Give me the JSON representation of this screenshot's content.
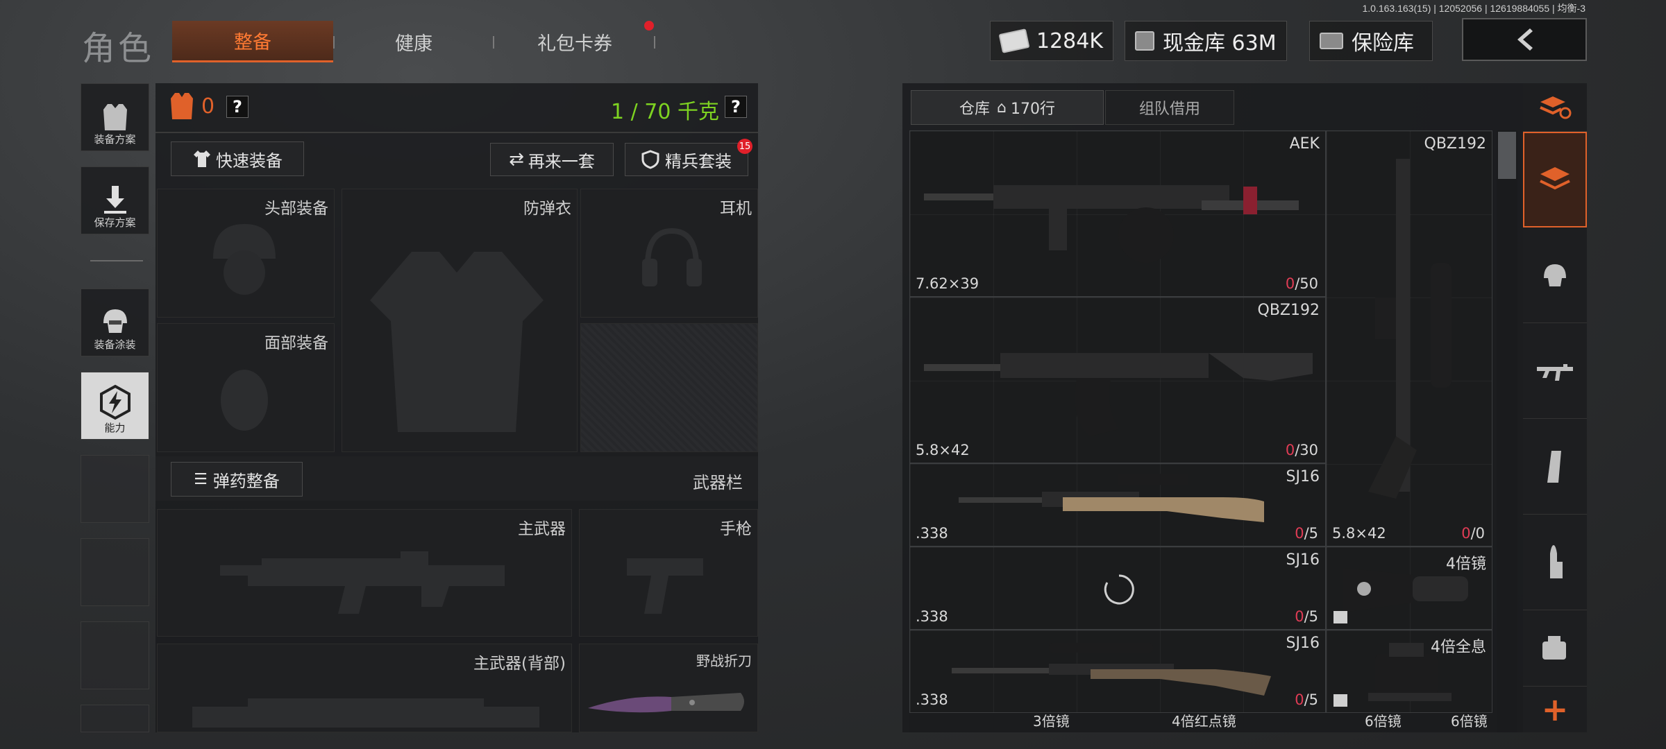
{
  "version_text": "1.0.163.163(15) | 12052056 | 12619884055 | 均衡-3",
  "page_title": "角色",
  "tabs": [
    {
      "label": "整备",
      "active": true
    },
    {
      "label": "健康",
      "active": false
    },
    {
      "label": "礼包卡券",
      "active": false,
      "has_badge": true
    }
  ],
  "currencies": [
    {
      "label": "1284K",
      "icon": "cash-icon"
    },
    {
      "label": "现金库 63M",
      "icon": "vault-icon"
    },
    {
      "label": "保险库",
      "icon": "safe-icon"
    }
  ],
  "side_buttons": [
    {
      "label": "装备方案",
      "icon": "vest-icon"
    },
    {
      "label": "保存方案",
      "icon": "download-icon"
    },
    {
      "label": "装备涂装",
      "icon": "helmet-icon"
    },
    {
      "label": "能力",
      "icon": "lightning-icon",
      "active": true
    }
  ],
  "loadout": {
    "armor_count": "0",
    "weight": "1 / 70 千克",
    "quick_equip": "快速装备",
    "again_label": "再来一套",
    "elite_label": "精兵套装",
    "elite_badge": "15",
    "slots": {
      "head": "头部装备",
      "vest": "防弹衣",
      "headset": "耳机",
      "face": "面部装备"
    },
    "ammo_equip": "弹药整备",
    "weapon_bar": "武器栏",
    "weapon_slots": {
      "primary": "主武器",
      "pistol": "手枪",
      "primary_back": "主武器(背部)",
      "knife": "野战折刀"
    }
  },
  "storage": {
    "tabs": [
      {
        "label": "仓库",
        "extra": "170行",
        "active": true
      },
      {
        "label": "组队借用",
        "active": false
      }
    ],
    "items": [
      {
        "name": "AEK",
        "caliber": "7.62×39",
        "ammo_cur": "0",
        "ammo_max": "/50"
      },
      {
        "name": "QBZ192",
        "caliber": "5.8×42",
        "ammo_cur": "0",
        "ammo_max": "/0"
      },
      {
        "name": "QBZ192",
        "caliber": "5.8×42",
        "ammo_cur": "0",
        "ammo_max": "/30"
      },
      {
        "name": "SJ16",
        "caliber": ".338",
        "ammo_cur": "0",
        "ammo_max": "/5"
      },
      {
        "name": "SJ16",
        "caliber": ".338",
        "ammo_cur": "0",
        "ammo_max": "/5"
      },
      {
        "name": "SJ16",
        "caliber": ".338",
        "ammo_cur": "0",
        "ammo_max": "/5"
      },
      {
        "name": "4倍镜"
      },
      {
        "name": "4倍全息"
      }
    ],
    "bottom_row": [
      "3倍镜",
      "4倍红点镜",
      "6倍镜",
      "6倍镜"
    ]
  },
  "right_tabs": [
    "refresh-stack-icon",
    "stack-icon",
    "helmet-icon",
    "rifle-icon",
    "magazine-icon",
    "ammo-icon",
    "scope-icon",
    "plus-icon"
  ],
  "colors": {
    "accent": "#e0612a",
    "green": "#7ed321",
    "ammo_red": "#e03c55"
  }
}
